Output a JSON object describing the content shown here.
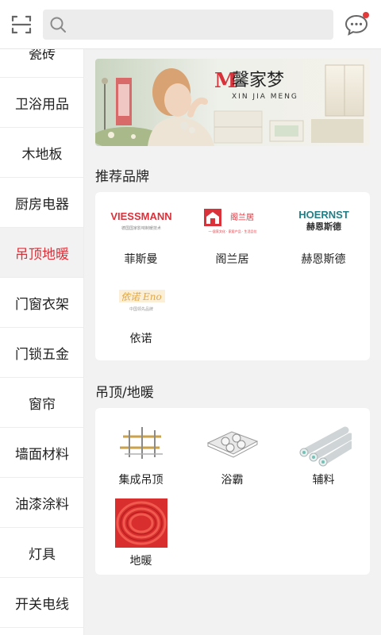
{
  "search": {
    "placeholder": "",
    "value": ""
  },
  "categories": [
    {
      "label": "瓷砖"
    },
    {
      "label": "卫浴用品"
    },
    {
      "label": "木地板"
    },
    {
      "label": "厨房电器"
    },
    {
      "label": "吊顶地暖"
    },
    {
      "label": "门窗衣架"
    },
    {
      "label": "门锁五金"
    },
    {
      "label": "窗帘"
    },
    {
      "label": "墙面材料"
    },
    {
      "label": "油漆涂料"
    },
    {
      "label": "灯具"
    },
    {
      "label": "开关电线"
    }
  ],
  "active_category": "吊顶地暖",
  "banner": {
    "brand_cn": "馨家梦",
    "brand_en": "XIN JIA MENG",
    "mark": "M"
  },
  "recommended": {
    "title": "推荐品牌",
    "brands": [
      {
        "name": "菲斯曼",
        "logo_text": "VIESSMANN",
        "logo_sub": "德国国家影响制暖技术"
      },
      {
        "name": "阁兰居",
        "logo_text": "阁兰居",
        "logo_sub": "一·居家文化 · 家居产品 · 生活品位"
      },
      {
        "name": "赫恩斯德",
        "logo_text": "HOERNST",
        "logo_sub": "赫恩斯德"
      },
      {
        "name": "依诺",
        "logo_text": "依诺 Eno",
        "logo_sub": "中国领先品牌"
      }
    ]
  },
  "subcategory": {
    "title": "吊顶/地暖",
    "items": [
      {
        "name": "集成吊顶"
      },
      {
        "name": "浴霸"
      },
      {
        "name": "辅料"
      },
      {
        "name": "地暖"
      }
    ]
  },
  "colors": {
    "accent": "#d9323a",
    "background": "#f2f2f2",
    "card": "#ffffff"
  }
}
